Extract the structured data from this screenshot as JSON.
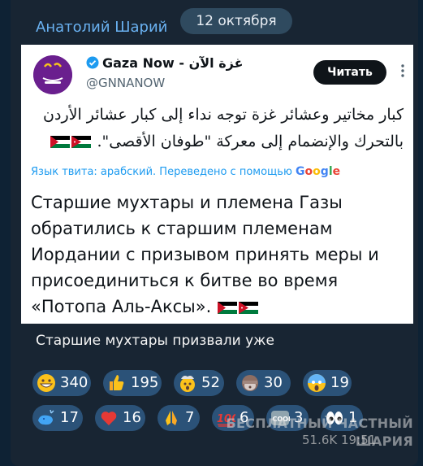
{
  "message": {
    "author": "Анатолий Шарий",
    "date": "12 октября",
    "caption": "Старшие мухтары призвали уже"
  },
  "tweet": {
    "name": "Gaza Now - غزة الآن",
    "handle": "@GNNANOW",
    "read_button": "Читать",
    "arabic_text": "كبار مخاتير وعشائر غزة توجه نداء إلى كبار عشائر الأردن بالتحرك والإنضمام إلى معركة \"طوفان الأقصى\".",
    "translation_note": "Язык твита: арабский. Переведено с помощью",
    "google": "Google",
    "translated_text": "Старшие мухтары и племена Газы обратились к старшим племенам Иордании с призывом принять меры и присоединиться к битве во время «Потопа Аль-Аксы».",
    "avatar_text": "غزة الآن",
    "avatar_sub": "Gaza Now",
    "flag_icons": [
      "jordan-flag",
      "palestine-flag"
    ]
  },
  "reactions": [
    {
      "icon": "grin-icon",
      "count": "340"
    },
    {
      "icon": "thumbs-up-icon",
      "count": "195"
    },
    {
      "icon": "exploding-head-icon",
      "count": "52"
    },
    {
      "icon": "see-no-evil-monkey-icon",
      "count": "30"
    },
    {
      "icon": "screaming-face-icon",
      "count": "19"
    },
    {
      "icon": "whale-icon",
      "count": "17"
    },
    {
      "icon": "heart-icon",
      "count": "16"
    },
    {
      "icon": "praying-hands-icon",
      "count": "7"
    },
    {
      "icon": "hundred-icon",
      "count": "6"
    },
    {
      "icon": "cool-icon",
      "count": "3"
    },
    {
      "icon": "eyes-icon",
      "count": "1"
    }
  ],
  "watermark": {
    "line1": "БЕСПЛАТНЫЙ ЧАСТНЫЙ",
    "line2": "ШАРИЯ",
    "line3": "51.6K 19:51"
  },
  "colors": {
    "background": "#0e2234",
    "bubble": "#182533",
    "author": "#6ab2f2",
    "reaction": "#2b5278",
    "link": "#1d9bf0"
  }
}
